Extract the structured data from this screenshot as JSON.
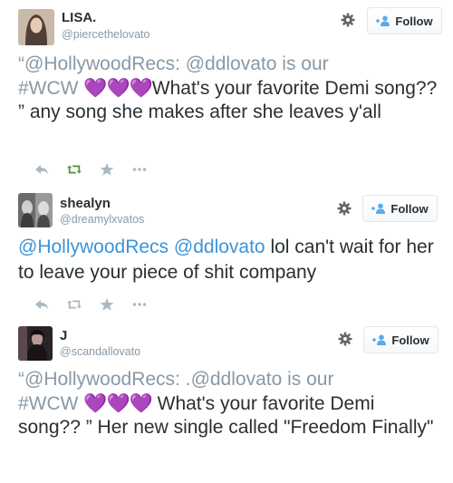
{
  "tweets": [
    {
      "display_name": "LISA.",
      "handle": "@piercethelovato",
      "follow_label": "Follow",
      "text": {
        "open_quote": "“",
        "mention1": "@HollywoodRecs",
        "sep": ": ",
        "mention2": "@ddlovato",
        "after_mention2": " is our",
        "hashtag": "#WCW",
        "hearts": "💜💜💜",
        "rest": "What's your favorite Demi song?? ” any song she makes after she leaves y'all"
      }
    },
    {
      "display_name": "shealyn",
      "handle": "@dreamylxvatos",
      "follow_label": "Follow",
      "text": {
        "mention1": "@HollywoodRecs",
        "mention2": "@ddlovato",
        "rest": " lol can't wait for her to leave your piece of shit company"
      }
    },
    {
      "display_name": "J",
      "handle": "@scandallovato",
      "follow_label": "Follow",
      "text": {
        "open_quote": "“",
        "mention1": "@HollywoodRecs",
        "sep": ": .",
        "mention2": "@ddlovato",
        "after_mention2": " is our",
        "hashtag": "#WCW",
        "hearts": "💜💜💜",
        "rest": " What's your favorite Demi song?? ” Her new single called \"Freedom Finally\""
      }
    }
  ],
  "colors": {
    "link": "#3b94d9",
    "quoted_grey": "#8899a6",
    "retweet_active": "#5c913b",
    "heart_purple": "#a88fd6"
  },
  "icons": [
    "gear-icon",
    "follow-user-icon",
    "reply-icon",
    "retweet-icon",
    "favorite-star-icon",
    "more-icon"
  ]
}
